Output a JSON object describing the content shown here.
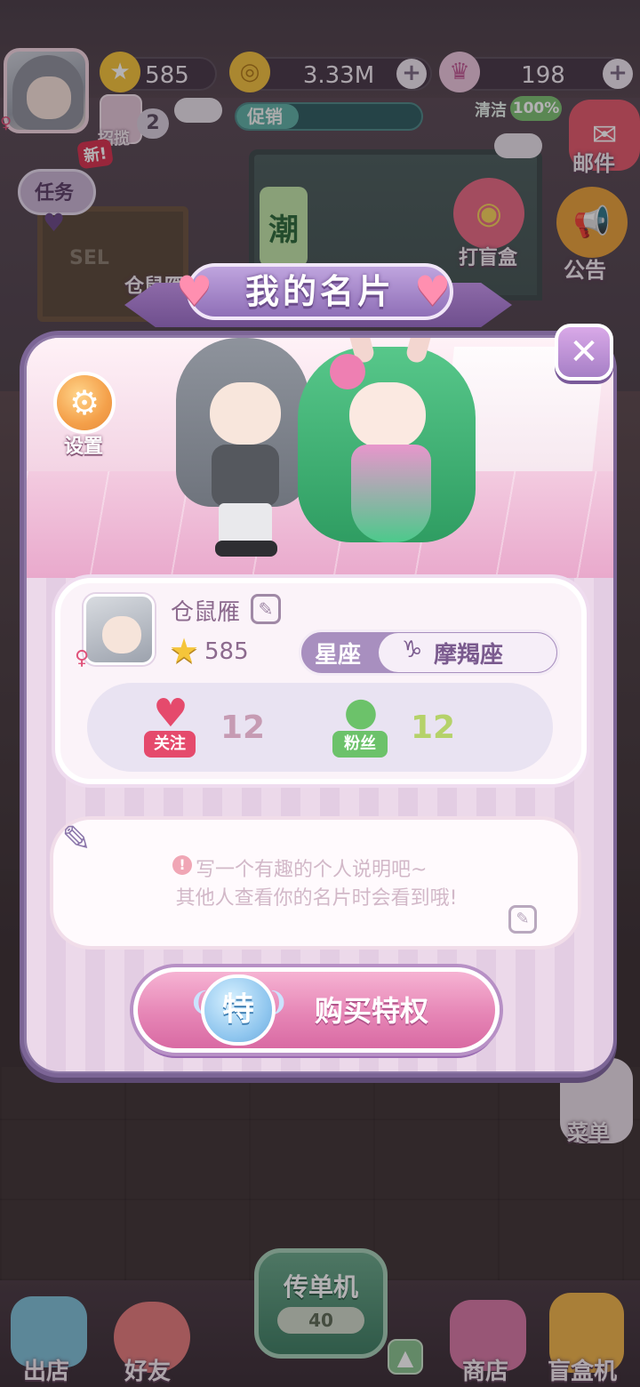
{
  "top_bar": {
    "stars": "585",
    "coins": "3.33M",
    "gems": "198",
    "invite_count": "2",
    "invite_label": "招揽",
    "promo_label": "促销",
    "clean_label": "清洁",
    "clean_value": "100%"
  },
  "side_left": {
    "task_label": "任务",
    "new_tag": "新!",
    "chalk_text": "SEL",
    "partial_label": "仓鼠雁"
  },
  "side_right": {
    "mail_label": "邮件",
    "blindbox_label": "打盲盒",
    "notice_label": "公告",
    "menu_label": "菜单",
    "trend_sign": "潮"
  },
  "card": {
    "title": "我的名片",
    "settings_label": "设置",
    "close_symbol": "✕",
    "name": "仓鼠雁",
    "stars": "585",
    "zodiac_label": "星座",
    "zodiac_symbol": "♑",
    "zodiac_value": "摩羯座",
    "follow_label": "关注",
    "follow_count": "12",
    "fans_label": "粉丝",
    "fans_count": "12",
    "bio_line1": "写一个有趣的个人说明吧~",
    "bio_line2": "其他人查看你的名片时会看到哦!",
    "buy_icon_text": "特",
    "buy_label": "购买特权"
  },
  "bottom_nav": {
    "leave_label": "出店",
    "friends_label": "好友",
    "flyer_label": "传单机",
    "flyer_count": "40",
    "shop_label": "商店",
    "blindbox_machine_label": "盲盒机"
  }
}
